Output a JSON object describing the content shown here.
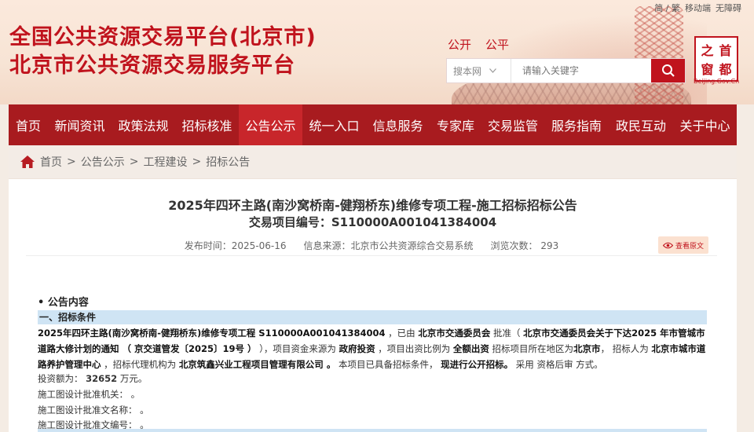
{
  "util_links": [
    "简 / 繁",
    "移动端",
    "无障碍"
  ],
  "site": {
    "title_line1": "全国公共资源交易平台(北京市)",
    "title_line2": "北京市公共资源交易服务平台"
  },
  "slogan": [
    "公开",
    "公平"
  ],
  "search": {
    "scope": "搜本网",
    "placeholder": "请输入关键字"
  },
  "logo": {
    "chars": [
      "首",
      "之",
      "都",
      "窗"
    ],
    "sub": "Beijing.Gov.Cn"
  },
  "nav": [
    "首页",
    "新闻资讯",
    "政策法规",
    "招标核准",
    "公告公示",
    "统一入口",
    "信息服务",
    "专家库",
    "交易监管",
    "服务指南",
    "政民互动",
    "关于中心"
  ],
  "nav_active": "公告公示",
  "breadcrumb": [
    "首页",
    "公告公示",
    "工程建设",
    "招标公告"
  ],
  "article": {
    "title": "2025年四环主路(南沙窝桥南-健翔桥东)维修专项工程-施工招标招标公告",
    "code": "交易项目编号：S110000A001041384004",
    "date": "发布时间：2025-06-16",
    "source": "信息来源：北京市公共资源综合交易系统",
    "views": "浏览次数： 293",
    "view_original": "查看原文",
    "section_title": "• 公告内容",
    "sub_title": "一、招标条件",
    "para": {
      "p1": "2025年四环主路(南沙窝桥南-健翔桥东)维修专项工程 S110000A001041384004",
      "p2": " ，已由 ",
      "p3": "北京市交通委员会",
      "p4": " 批准（ ",
      "p5": "北京市交通委员会关于下达2025 年市管城市道路大修计划的通知 （ 京交道管发〔2025〕19号 ）",
      "p6": " ），项目资金来源为 ",
      "p7": "政府投资",
      "p8": " ，项目出资比例为 ",
      "p9": "全额出资",
      "p10": " 招标项目所在地区为",
      "p11": "北京市",
      "p12": "， 招标人为 ",
      "p13": "北京市城市道路养护管理中心",
      "p14": " ，招标代理机构为 ",
      "p15": "北京筑鑫兴业工程项目管理有限公司 。",
      "p16": " 本项目已具备招标条件， ",
      "p17": "现进行公开招标。",
      "p18": " 采用 资格后审 方式。"
    },
    "investment_label": "投资额为：",
    "investment_value": "32652",
    "investment_unit": " 万元。",
    "line_org": "施工图设计批准机关： 。",
    "line_doc": "施工图设计批准文名称： 。",
    "line_no": "施工图设计批准文编号： 。"
  },
  "colors": {
    "brand_red": "#c0131d",
    "nav_red": "#a81b1f",
    "highlight_blue": "#cfe4f4"
  }
}
